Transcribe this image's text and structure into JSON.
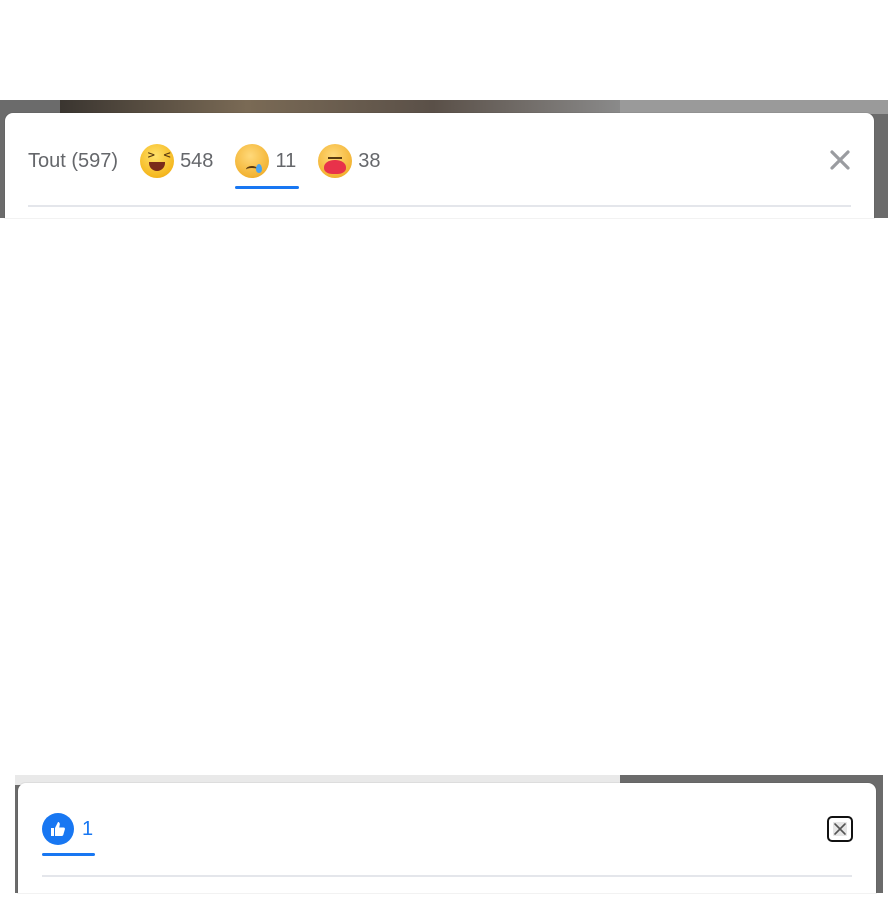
{
  "dialog1": {
    "tabs": [
      {
        "label": "Tout (597)",
        "icon": "none"
      },
      {
        "count": "548",
        "icon": "haha-emoji-icon"
      },
      {
        "count": "11",
        "icon": "sad-emoji-icon"
      },
      {
        "count": "38",
        "icon": "care-emoji-icon"
      }
    ],
    "active_tab": 2,
    "close_icon": "close-icon"
  },
  "dialog2": {
    "tabs": [
      {
        "count": "1",
        "icon": "like-icon"
      }
    ],
    "active_tab": 0,
    "close_icon": "close-icon"
  },
  "colors": {
    "accent": "#1877f2",
    "text_secondary": "#65676b",
    "divider": "#e4e6eb"
  }
}
